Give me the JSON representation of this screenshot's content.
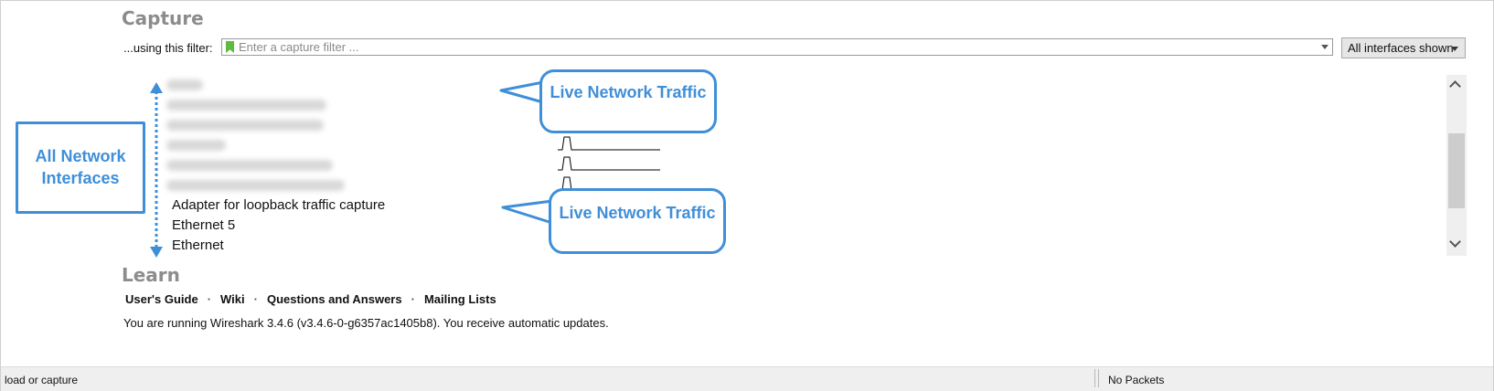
{
  "capture": {
    "heading": "Capture",
    "filter_label": "...using this filter:",
    "filter_placeholder": "Enter a capture filter ...",
    "interfaces_dropdown": "All interfaces shown"
  },
  "interfaces": [
    {
      "name": "",
      "redacted": true,
      "traffic": "busy"
    },
    {
      "name": "",
      "redacted": true,
      "traffic": "flat"
    },
    {
      "name": "",
      "redacted": true,
      "traffic": "flat"
    },
    {
      "name": "",
      "redacted": true,
      "traffic": "single-spike"
    },
    {
      "name": "",
      "redacted": true,
      "traffic": "single-spike"
    },
    {
      "name": "",
      "redacted": true,
      "traffic": "single-spike"
    },
    {
      "name": "Adapter for loopback traffic capture",
      "redacted": false,
      "traffic": "light"
    },
    {
      "name": "Ethernet 5",
      "redacted": false,
      "traffic": "flat"
    },
    {
      "name": "Ethernet",
      "redacted": false,
      "traffic": "flat"
    }
  ],
  "learn": {
    "heading": "Learn",
    "links": [
      "User's Guide",
      "Wiki",
      "Questions and Answers",
      "Mailing Lists"
    ],
    "version_text": "You are running Wireshark 3.4.6 (v3.4.6-0-g6357ac1405b8). You receive automatic updates."
  },
  "statusbar": {
    "left": "load or capture",
    "right": "No Packets"
  },
  "annotations": {
    "all_interfaces": "All Network Interfaces",
    "live_traffic_1": "Live Network Traffic",
    "live_traffic_2": "Live Network Traffic"
  },
  "colors": {
    "heading": "#8c8c8c",
    "annotation_blue": "#3f8fd8",
    "bookmark_green": "#5dbb3f",
    "statusbar_bg": "#efefef"
  }
}
